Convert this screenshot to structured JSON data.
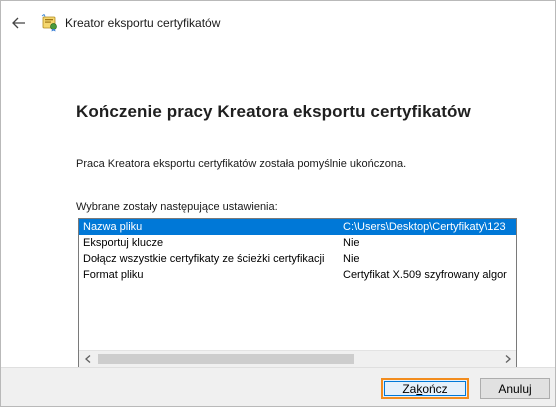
{
  "window": {
    "title": "Kreator eksportu certyfikatów"
  },
  "icons": {
    "back": "back-arrow-icon",
    "wizard": "certificate-wizard-icon",
    "scroll_left": "chevron-left-icon",
    "scroll_right": "chevron-right-icon"
  },
  "content": {
    "heading": "Kończenie pracy Kreatora eksportu certyfikatów",
    "completion_text": "Praca Kreatora eksportu certyfikatów została pomyślnie ukończona.",
    "settings_label": "Wybrane zostały następujące ustawienia:"
  },
  "settings_list": {
    "rows": [
      {
        "name": "Nazwa pliku",
        "value": "C:\\Users\\Desktop\\Certyfikaty\\123",
        "selected": true
      },
      {
        "name": "Eksportuj klucze",
        "value": "Nie",
        "selected": false
      },
      {
        "name": "Dołącz wszystkie certyfikaty ze ścieżki certyfikacji",
        "value": "Nie",
        "selected": false
      },
      {
        "name": "Format pliku",
        "value": "Certyfikat X.509 szyfrowany algor",
        "selected": false
      }
    ]
  },
  "buttons": {
    "finish_pre": "Za",
    "finish_accel": "k",
    "finish_post": "ończ",
    "cancel": "Anuluj"
  },
  "colors": {
    "selection": "#0078d7",
    "focus_highlight": "#f28c1e",
    "footer_bg": "#f0f0f0"
  }
}
